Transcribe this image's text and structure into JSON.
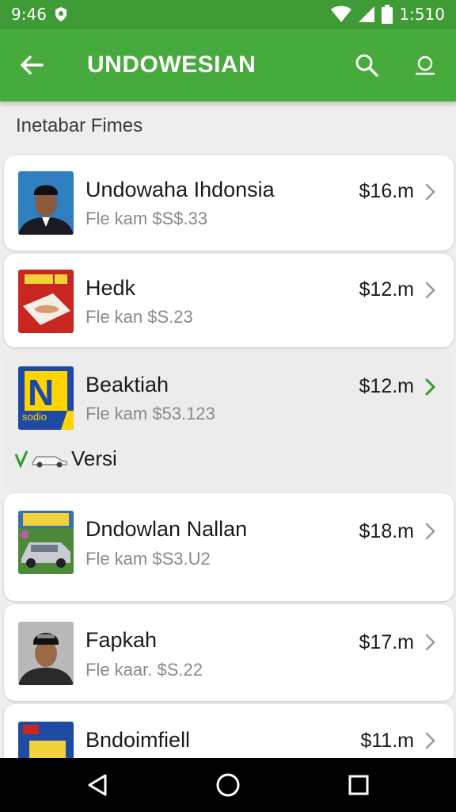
{
  "status_bar": {
    "time": "9:46",
    "clock": "1:510"
  },
  "app_bar": {
    "title": "UNDOWESIAN"
  },
  "section": {
    "header": "Inetabar Fimes"
  },
  "items": [
    {
      "title": "Undowaha Ihdonsia",
      "subtitle": "Fle kam $S$.33",
      "price": "$16.m"
    },
    {
      "title": "Hedk",
      "subtitle": "Fle kan $S.23",
      "price": "$12.m"
    },
    {
      "title": "Beaktiah",
      "subtitle": "Fle kam $53.123",
      "price": "$12.m",
      "thumb_text": "N",
      "thumb_caption": "sodio"
    },
    {
      "title": "Dndowlan Nallan",
      "subtitle": "Fle kam $S3.U2",
      "price": "$18.m"
    },
    {
      "title": "Fapkah",
      "subtitle": "Fle kaar. $S.22",
      "price": "$17.m"
    },
    {
      "title": "Bndoimfiell",
      "subtitle": "",
      "price": "$11.m"
    }
  ],
  "version": {
    "label": "Versi"
  },
  "colors": {
    "appbar": "#46aa3c",
    "statusbar": "#3f9b36",
    "accent_green": "#2e9b2e"
  },
  "icons": [
    "back-arrow-icon",
    "search-icon",
    "account-icon",
    "chevron-right-icon",
    "nav-back-icon",
    "nav-home-icon",
    "nav-recents-icon"
  ]
}
